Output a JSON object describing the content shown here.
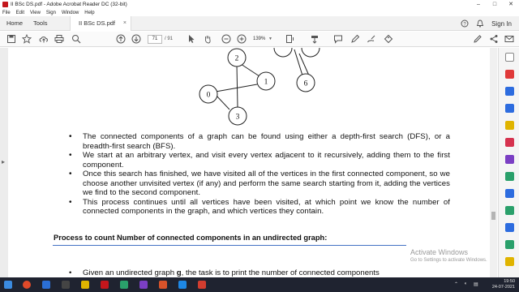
{
  "window": {
    "title": "II BSc DS.pdf - Adobe Acrobat Reader DC (32-bit)",
    "controls": [
      "–",
      "□",
      "✕"
    ]
  },
  "menu": [
    "File",
    "Edit",
    "View",
    "Sign",
    "Window",
    "Help"
  ],
  "tabs": {
    "home": "Home",
    "tools": "Tools",
    "document": "II BSc DS.pdf",
    "document_close": "×",
    "sign_in": "Sign In"
  },
  "toolbar": {
    "current_page": "71",
    "total_pages": "/ 91",
    "zoom": "139%"
  },
  "graph": {
    "nodes": [
      "2",
      "1",
      "0",
      "3",
      "6"
    ]
  },
  "content": {
    "bullets": [
      "The connected components of a graph can be found using either a depth-first search (DFS), or a breadth-first search (BFS).",
      "We start at an arbitrary vertex, and visit every vertex adjacent to it recursively, adding them to the first component.",
      "Once this search has finished, we have visited all of the vertices in the first connected component, so we choose another unvisited vertex (if any) and perform the same search starting from it, adding the vertices we find to the second component.",
      "This process continues until all vertices have been visited, at which point we know the number of connected components in the graph, and which vertices they contain."
    ],
    "heading": "Process to count Number of connected components in an undirected graph:",
    "last_line_pre": "Given an undirected graph ",
    "last_line_bold": "g",
    "last_line_post": ", the task is to print the number of connected components"
  },
  "watermark": {
    "line1": "Activate Windows",
    "line2": "Go to Settings to activate Windows."
  },
  "taskbar": {
    "time": "19:50",
    "date": "24-07-2021"
  },
  "colors": {
    "accent_blue": "#4472c4",
    "acrobat_red": "#c4161c",
    "taskbar": "#1f2330"
  }
}
